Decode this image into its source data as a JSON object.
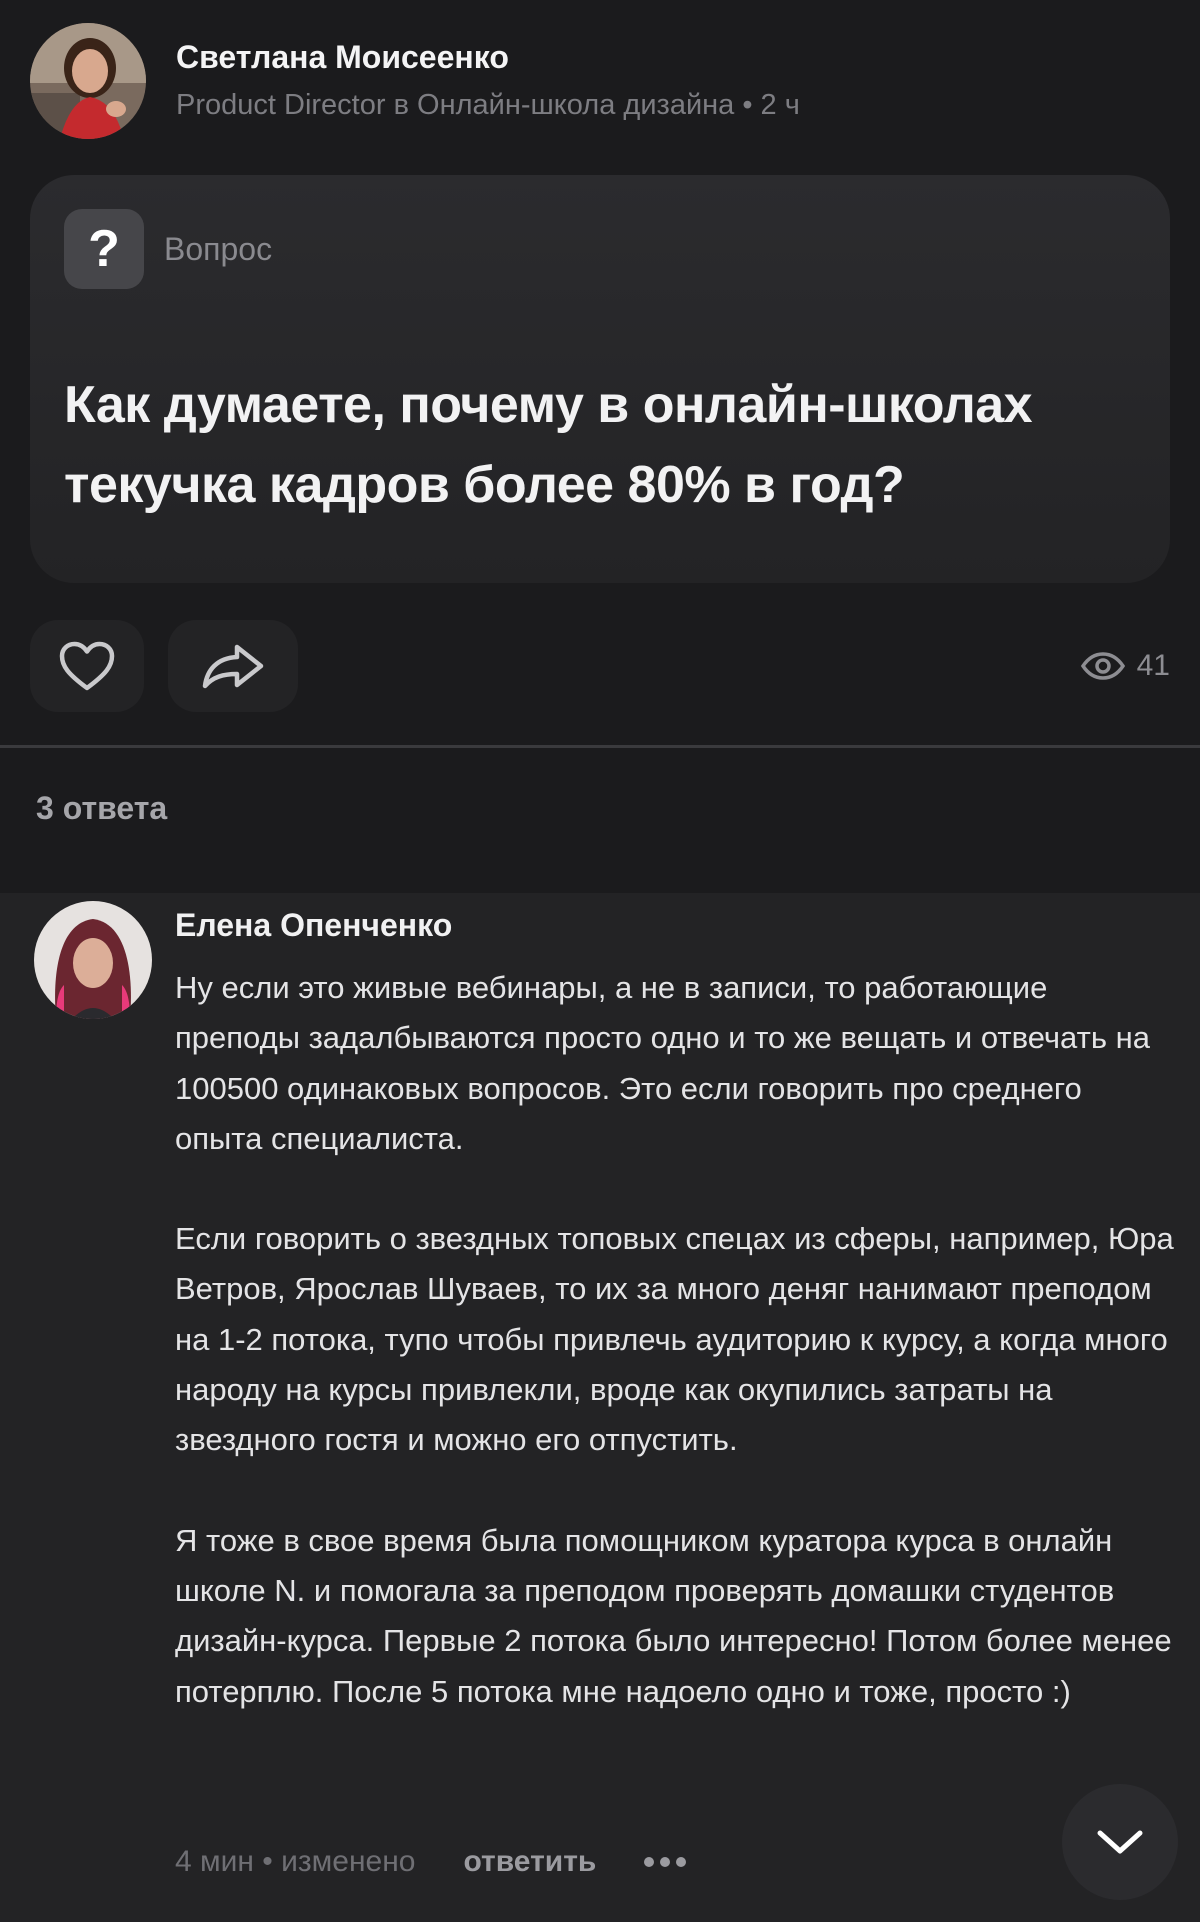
{
  "post": {
    "author_name": "Светлана Моисеенко",
    "author_meta": "Product Director в Онлайн-школа дизайна • 2 ч",
    "avatar_icon": "user-avatar-photo",
    "question_badge": "Вопрос",
    "question_icon": "?",
    "question_text": "Как думаете, почему в онлайн-школах текучка кадров более 80% в год?",
    "views_count": "41",
    "like_icon": "heart-icon",
    "share_icon": "share-arrow-icon",
    "views_icon": "eye-icon"
  },
  "answers": {
    "count_label": "3 ответа"
  },
  "comment": {
    "author_name": "Елена Опенченко",
    "avatar_icon": "user-avatar-photo",
    "paragraphs": [
      "Ну если это живые вебинары, а не в записи, то работающие преподы задалбываются просто одно и то же вещать и отвечать на 100500 одинаковых вопросов. Это если говорить про среднего опыта специалиста.",
      "Если говорить о звездных топовых спецах из сферы, например, Юра Ветров, Ярослав Шуваев, то их за много деняг нанимают преподом на 1-2 потока, тупо чтобы привлечь аудиторию к курсу, а когда много народу на курсы привлекли, вроде как окупились затраты на звездного гостя и можно его отпустить.",
      "Я тоже в свое время была помощником куратора курса в онлайн школе N. и помогала за преподом проверять домашки студентов дизайн-курса. Первые 2 потока было интересно! Потом более менее потерплю. После 5 потока мне надоело одно и тоже, просто :)"
    ],
    "meta": "4 мин • изменено",
    "reply_label": "ответить",
    "more_icon": "more-dots-icon"
  },
  "scroll_icon": "chevron-down-icon",
  "colors": {
    "background": "#1b1b1d",
    "card": "#2b2b2e",
    "text_primary": "#f2f2f3",
    "text_secondary": "#7d7d82"
  }
}
